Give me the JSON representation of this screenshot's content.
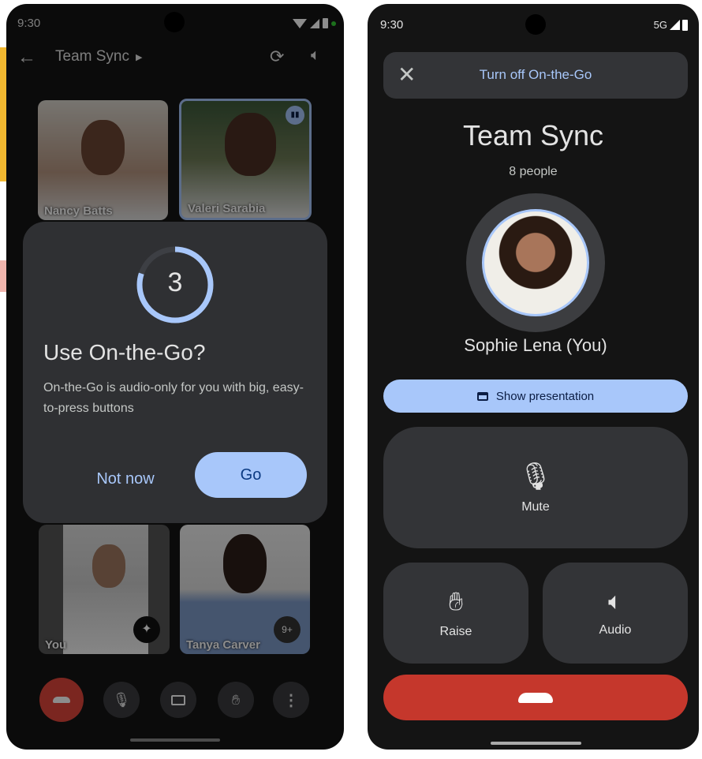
{
  "left": {
    "status": {
      "time": "9:30"
    },
    "header": {
      "title": "Team Sync"
    },
    "tiles": [
      {
        "name": "Nancy Batts"
      },
      {
        "name": "Valeri Sarabia"
      },
      {
        "name": "You"
      },
      {
        "name": "Tanya Carver",
        "badge": "9+"
      }
    ],
    "dialog": {
      "countdown": "3",
      "countdown_progress": 0.8,
      "title": "Use On-the-Go?",
      "body": "On-the-Go is audio-only for you with big, easy-to-press buttons",
      "not_now": "Not now",
      "go": "Go"
    }
  },
  "right": {
    "status": {
      "time": "9:30",
      "network": "5G"
    },
    "turn_off": "Turn off On-the-Go",
    "title": "Team Sync",
    "people": "8 people",
    "self_name": "Sophie Lena (You)",
    "show_presentation": "Show presentation",
    "mute": "Mute",
    "raise": "Raise",
    "audio": "Audio"
  },
  "colors": {
    "accent": "#a8c7fa",
    "end_call": "#c5372c",
    "surface": "#333437"
  }
}
